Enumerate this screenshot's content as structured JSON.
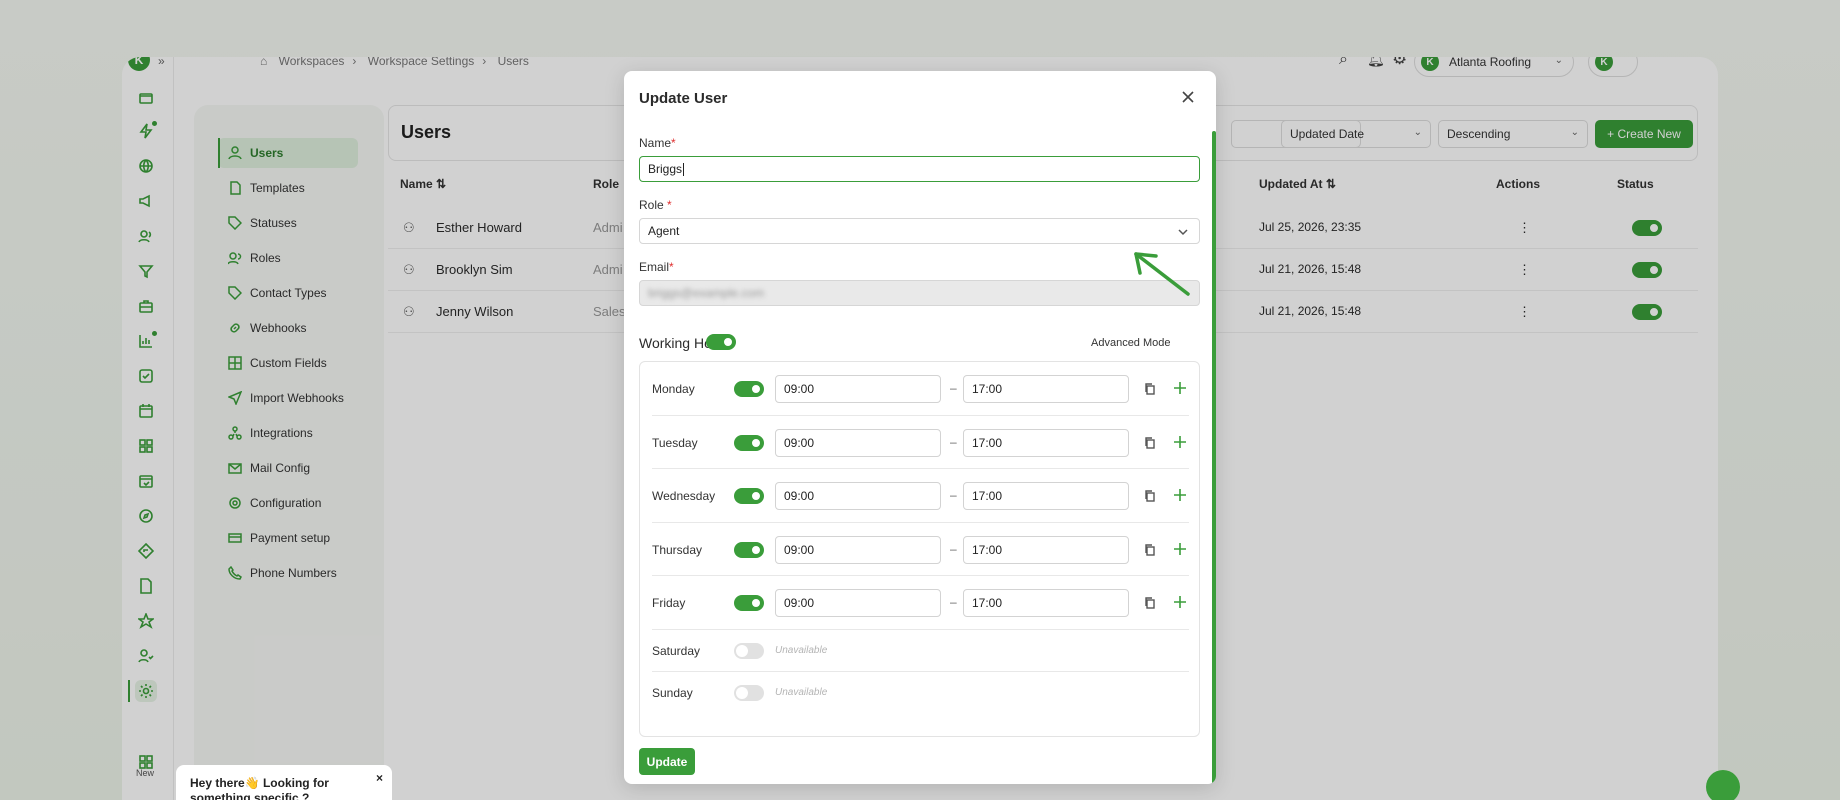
{
  "breadcrumb": [
    "Workspaces",
    "Workspace Settings",
    "Users"
  ],
  "account": {
    "initial": "K",
    "name": "Atlanta Roofing"
  },
  "settings_nav": [
    {
      "label": "Users",
      "icon": "user-icon",
      "active": true
    },
    {
      "label": "Templates",
      "icon": "file-icon"
    },
    {
      "label": "Statuses",
      "icon": "tag-icon"
    },
    {
      "label": "Roles",
      "icon": "users-icon"
    },
    {
      "label": "Contact Types",
      "icon": "tag-icon"
    },
    {
      "label": "Webhooks",
      "icon": "link-icon"
    },
    {
      "label": "Custom Fields",
      "icon": "grid-icon"
    },
    {
      "label": "Import Webhooks",
      "icon": "send-icon"
    },
    {
      "label": "Integrations",
      "icon": "integrations-icon"
    },
    {
      "label": "Mail Config",
      "icon": "mail-icon"
    },
    {
      "label": "Configuration",
      "icon": "gear-icon"
    },
    {
      "label": "Payment setup",
      "icon": "card-icon"
    },
    {
      "label": "Phone Numbers",
      "icon": "phone-icon"
    }
  ],
  "rail_new_label": "New",
  "main": {
    "title": "Users",
    "sort_field": "Updated Date",
    "sort_order": "Descending",
    "create_label": "+ Create New"
  },
  "table": {
    "headers": {
      "name": "Name",
      "role": "Role",
      "updated": "Updated At",
      "actions": "Actions",
      "status": "Status"
    },
    "rows": [
      {
        "name": "Esther Howard",
        "role": "Admi",
        "updated": "Jul 25, 2026, 23:35",
        "status": true
      },
      {
        "name": "Brooklyn Sim",
        "role": "Admi",
        "updated": "Jul 21, 2026, 15:48",
        "status": true
      },
      {
        "name": "Jenny Wilson",
        "role": "Sales",
        "updated": "Jul 21, 2026, 15:48",
        "status": true
      }
    ]
  },
  "chat": {
    "text": "Hey there👋 Looking for something specific ?",
    "close": "×"
  },
  "modal": {
    "title": "Update User",
    "name_label": "Name",
    "name_value": "Briggs",
    "role_label": "Role",
    "role_value": "Agent",
    "email_label": "Email",
    "email_value": "briggs@example.com",
    "required_mark": "*",
    "working_hours_title": "Working Hours",
    "advanced_mode_label": "Advanced Mode",
    "advanced_mode_on": true,
    "days": [
      {
        "name": "Monday",
        "enabled": true,
        "start": "09:00",
        "end": "17:00"
      },
      {
        "name": "Tuesday",
        "enabled": true,
        "start": "09:00",
        "end": "17:00"
      },
      {
        "name": "Wednesday",
        "enabled": true,
        "start": "09:00",
        "end": "17:00"
      },
      {
        "name": "Thursday",
        "enabled": true,
        "start": "09:00",
        "end": "17:00"
      },
      {
        "name": "Friday",
        "enabled": true,
        "start": "09:00",
        "end": "17:00"
      },
      {
        "name": "Saturday",
        "enabled": false,
        "unavailable_label": "Unavailable"
      },
      {
        "name": "Sunday",
        "enabled": false,
        "unavailable_label": "Unavailable"
      }
    ],
    "range_separator": "–",
    "update_label": "Update"
  },
  "colors": {
    "accent": "#3a9d3a",
    "required": "#e03030"
  }
}
